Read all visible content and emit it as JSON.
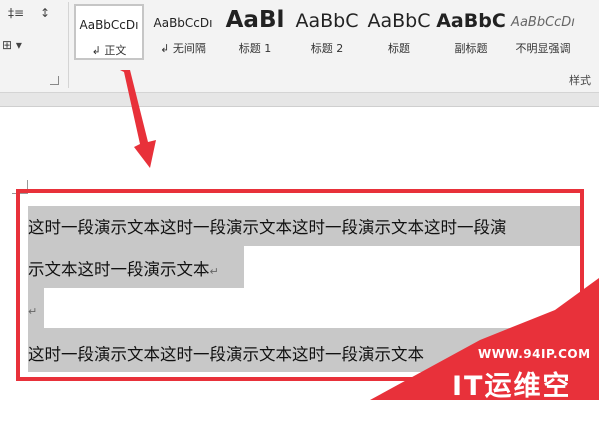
{
  "ribbon": {
    "left_tools": [
      {
        "name": "line-spacing-icon",
        "glyph": "‡"
      },
      {
        "name": "sort-icon",
        "glyph": "↕"
      },
      {
        "name": "paragraph-mark-icon",
        "glyph": "↵"
      },
      {
        "name": "borders-icon",
        "glyph": "⊞"
      }
    ],
    "styles": [
      {
        "sample": "AaBbCcDı",
        "label": "↲ 正文",
        "selected": true
      },
      {
        "sample": "AaBbCcDı",
        "label": "↲ 无间隔",
        "selected": false
      },
      {
        "sample": "AaBl",
        "label": "标题 1",
        "selected": false
      },
      {
        "sample": "AaBbC",
        "label": "标题 2",
        "selected": false
      },
      {
        "sample": "AaBbC",
        "label": "标题",
        "selected": false
      },
      {
        "sample": "AaBbC",
        "label": "副标题",
        "selected": false
      },
      {
        "sample": "AaBbCcDı",
        "label": "不明显强调",
        "selected": false
      }
    ],
    "group_label": "样式"
  },
  "document": {
    "line1": "这时一段演示文本这时一段演示文本这时一段演示文本这时一段演",
    "line2": "示文本这时一段演示文本",
    "empty_mark": "↵",
    "line3": "这时一段演示文本这时一段演示文本这时一段演示文本"
  },
  "watermark": {
    "url": "WWW.94IP.COM",
    "brand": "IT运维空间"
  },
  "colors": {
    "highlight": "#c8c8c8",
    "red": "#e8313a",
    "ribbon_bg": "#f3f3f3"
  }
}
